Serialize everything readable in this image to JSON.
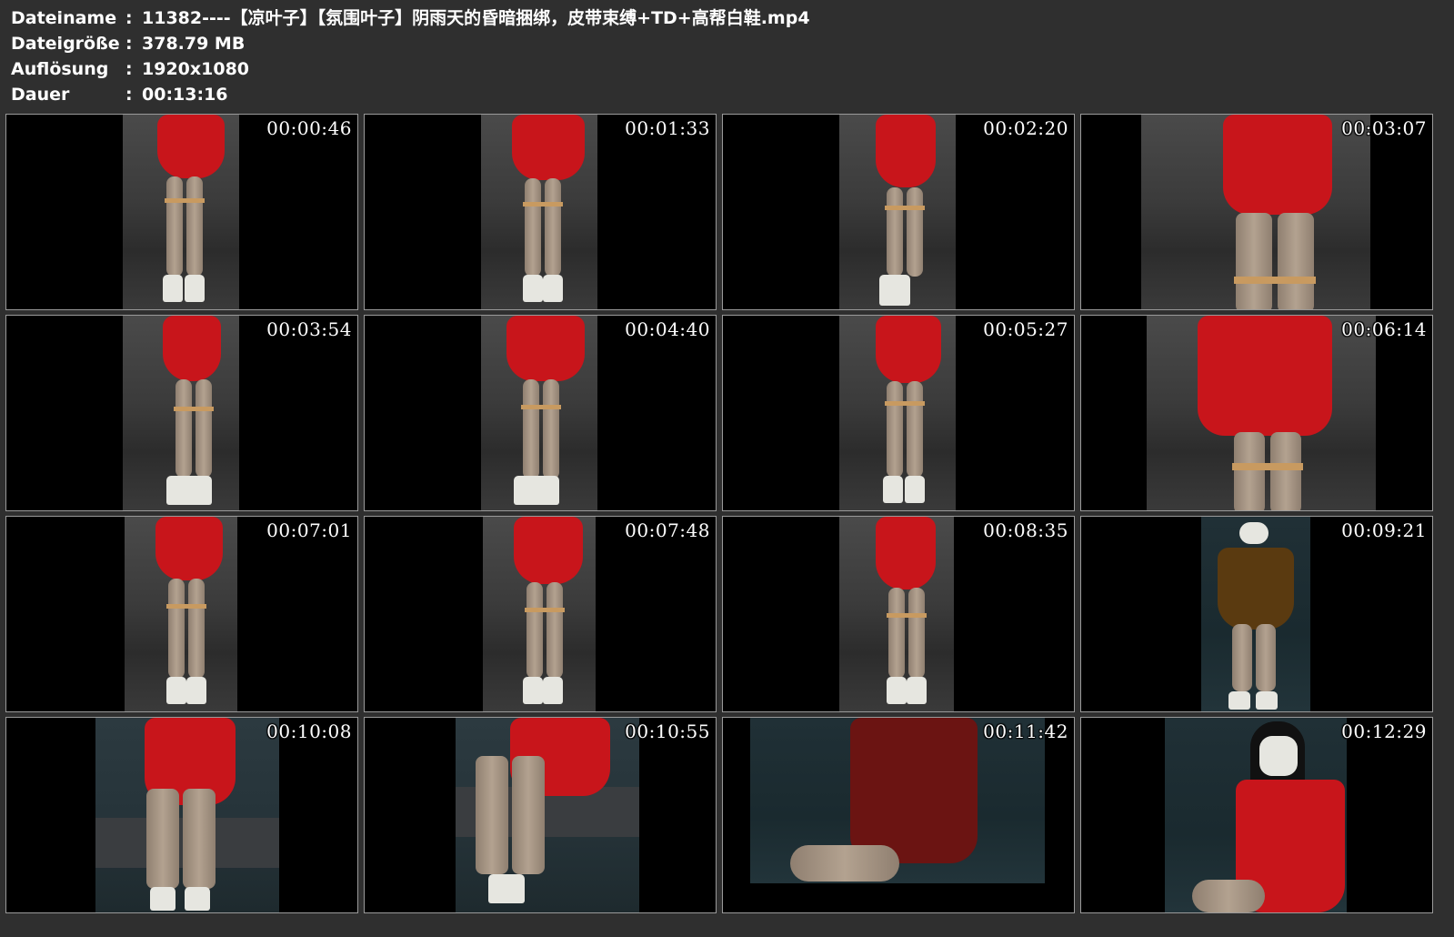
{
  "info": [
    {
      "label": "Dateiname",
      "value": "11382----【凉叶子】【氛围叶子】阴雨天的昏暗捆绑，皮带束缚+TD+高帮白鞋.mp4"
    },
    {
      "label": "Dateigröße",
      "value": "378.79 MB"
    },
    {
      "label": "Auflösung",
      "value": "1920x1080"
    },
    {
      "label": "Dauer",
      "value": "00:13:16"
    }
  ],
  "info_colon": ":",
  "thumbnails": [
    {
      "timestamp": "00:00:46"
    },
    {
      "timestamp": "00:01:33"
    },
    {
      "timestamp": "00:02:20"
    },
    {
      "timestamp": "00:03:07"
    },
    {
      "timestamp": "00:03:54"
    },
    {
      "timestamp": "00:04:40"
    },
    {
      "timestamp": "00:05:27"
    },
    {
      "timestamp": "00:06:14"
    },
    {
      "timestamp": "00:07:01"
    },
    {
      "timestamp": "00:07:48"
    },
    {
      "timestamp": "00:08:35"
    },
    {
      "timestamp": "00:09:21"
    },
    {
      "timestamp": "00:10:08"
    },
    {
      "timestamp": "00:10:55"
    },
    {
      "timestamp": "00:11:42"
    },
    {
      "timestamp": "00:12:29"
    }
  ],
  "colors": {
    "background": "#2f2f2f",
    "text": "#ffffff",
    "thumbnail_border": "#9a9a9a",
    "dress": "#c8151b"
  }
}
